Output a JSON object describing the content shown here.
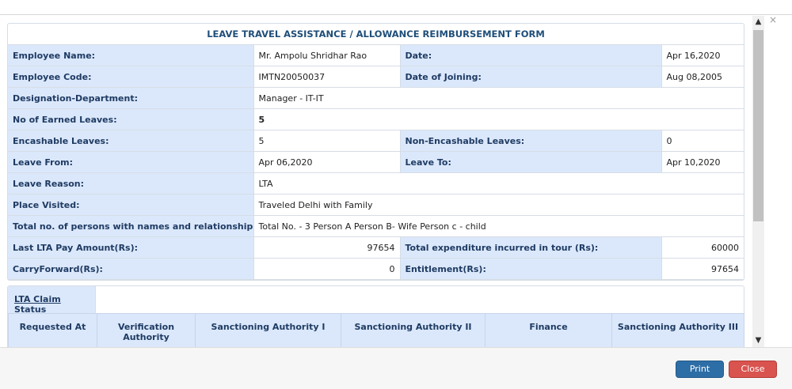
{
  "window": {
    "close_glyph": "×"
  },
  "form": {
    "title": "LEAVE TRAVEL ASSISTANCE / ALLOWANCE REIMBURSEMENT FORM",
    "employee_name_label": "Employee Name:",
    "employee_name": "Mr. Ampolu Shridhar Rao",
    "date_label": "Date:",
    "date": "Apr 16,2020",
    "employee_code_label": "Employee Code:",
    "employee_code": "IMTN20050037",
    "doj_label": "Date of Joining:",
    "doj": "Aug 08,2005",
    "designation_label": "Designation-Department:",
    "designation": "Manager - IT-IT",
    "earned_leaves_label": "No of Earned Leaves:",
    "earned_leaves": "5",
    "encashable_label": "Encashable Leaves:",
    "encashable": "5",
    "non_encashable_label": "Non-Encashable Leaves:",
    "non_encashable": "0",
    "leave_from_label": "Leave From:",
    "leave_from": "Apr 06,2020",
    "leave_to_label": "Leave To:",
    "leave_to": "Apr 10,2020",
    "leave_reason_label": "Leave Reason:",
    "leave_reason": "LTA",
    "place_label": "Place Visited:",
    "place": "Traveled Delhi with Family",
    "persons_label": "Total no. of persons with names and relationship:",
    "persons": "Total No. - 3 Person A Person B- Wife Person c - child",
    "last_lta_label": "Last LTA Pay Amount(Rs):",
    "last_lta": "97654",
    "expenditure_label": "Total expenditure incurred in tour (Rs):",
    "expenditure": "60000",
    "carry_label": "CarryForward(Rs):",
    "carry": "0",
    "entitlement_label": "Entitlement(Rs):",
    "entitlement": "97654"
  },
  "status": {
    "tab_label": "LTA Claim Status",
    "columns": [
      "Requested At",
      "Verification Authority",
      "Sanctioning Authority I",
      "Sanctioning Authority II",
      "Finance",
      "Sanctioning Authority III"
    ]
  },
  "footer": {
    "print_label": "Print",
    "close_label": "Close"
  }
}
